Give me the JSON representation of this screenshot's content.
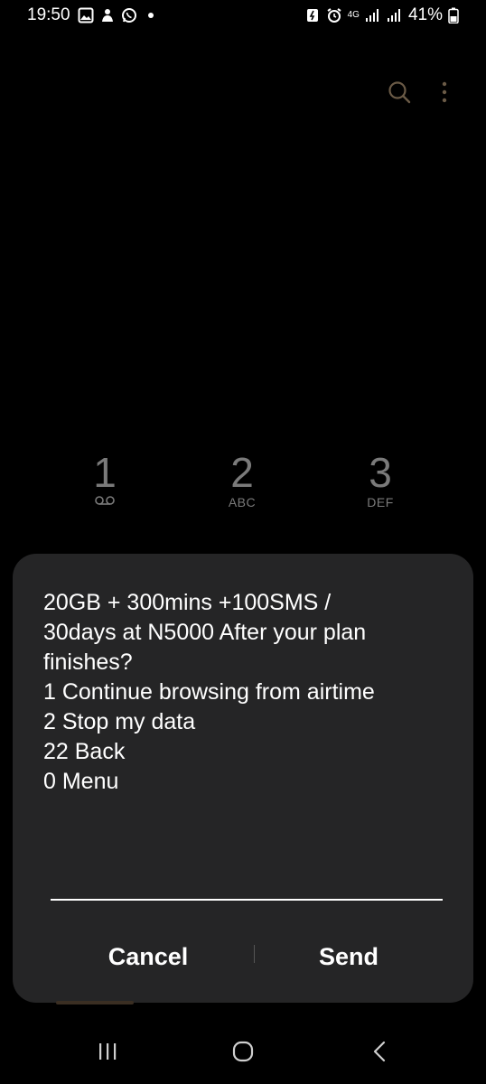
{
  "status_bar": {
    "time": "19:50",
    "network": "4G",
    "battery": "41%",
    "left_icons": [
      "gallery-icon",
      "notification-icon",
      "whatsapp-icon",
      "dot-icon"
    ],
    "right_icons": [
      "battery-saver-icon",
      "alarm-icon",
      "network-4g-icon",
      "signal-icon",
      "signal-icon",
      "battery-icon"
    ]
  },
  "app_bar": {
    "icons": [
      "search-icon",
      "more-options-icon"
    ]
  },
  "keypad": {
    "keys": [
      {
        "digit": "1",
        "letters": ""
      },
      {
        "digit": "2",
        "letters": "ABC"
      },
      {
        "digit": "3",
        "letters": "DEF"
      }
    ]
  },
  "dialog": {
    "message_lines": [
      "20GB + 300mins +100SMS /",
      "30days at N5000 After your plan",
      "finishes?",
      "1 Continue browsing from airtime",
      "2 Stop my data",
      "22 Back",
      "0 Menu"
    ],
    "input_value": "",
    "cancel_label": "Cancel",
    "send_label": "Send"
  },
  "nav_bar": {
    "icons": [
      "recents-icon",
      "home-icon",
      "back-icon"
    ]
  },
  "colors": {
    "background": "#000000",
    "dialog": "#252526",
    "keypad_text": "#7a7a7a",
    "text": "#ffffff"
  }
}
